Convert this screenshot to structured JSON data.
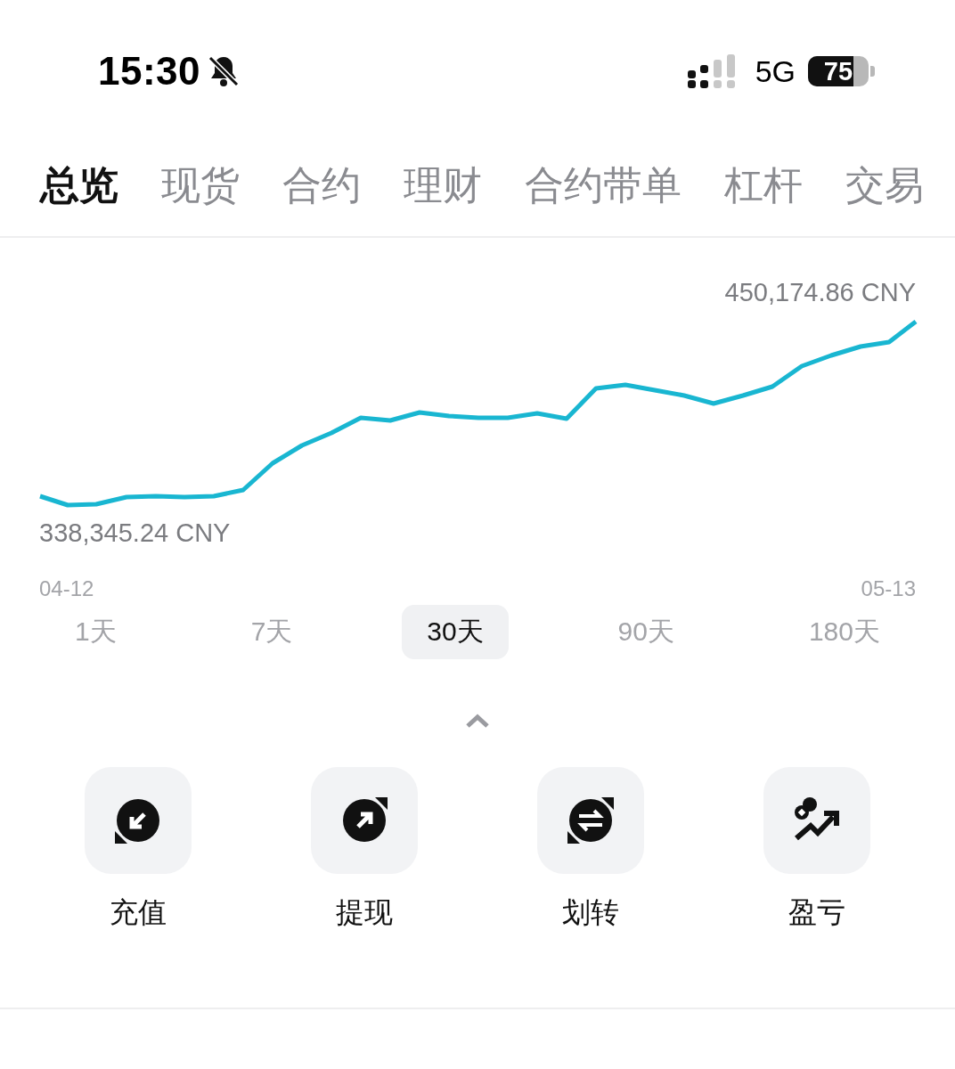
{
  "status_bar": {
    "time": "15:30",
    "network": "5G",
    "battery": "75"
  },
  "tabs": [
    {
      "label": "总览",
      "selected": true
    },
    {
      "label": "现货",
      "selected": false
    },
    {
      "label": "合约",
      "selected": false
    },
    {
      "label": "理财",
      "selected": false
    },
    {
      "label": "合约带单",
      "selected": false
    },
    {
      "label": "杠杆",
      "selected": false
    },
    {
      "label": "交易",
      "selected": false
    }
  ],
  "chart": {
    "max_label": "450,174.86 CNY",
    "min_label": "338,345.24 CNY",
    "start_date": "04-12",
    "end_date": "05-13"
  },
  "periods": [
    {
      "label": "1天",
      "selected": false
    },
    {
      "label": "7天",
      "selected": false
    },
    {
      "label": "30天",
      "selected": true
    },
    {
      "label": "90天",
      "selected": false
    },
    {
      "label": "180天",
      "selected": false
    }
  ],
  "actions": [
    {
      "label": "充值",
      "kind": "deposit"
    },
    {
      "label": "提现",
      "kind": "withdraw"
    },
    {
      "label": "划转",
      "kind": "transfer"
    },
    {
      "label": "盈亏",
      "kind": "pnl"
    }
  ]
}
